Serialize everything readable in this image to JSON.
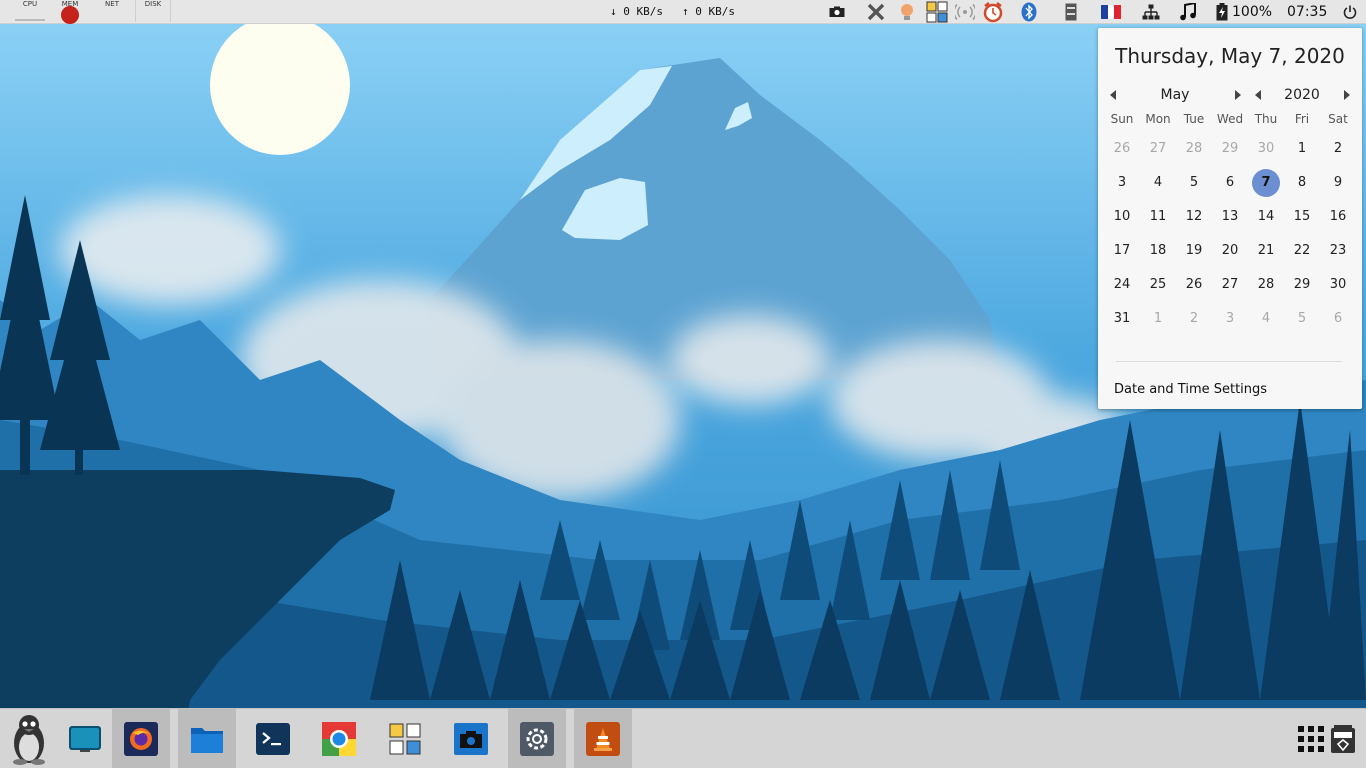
{
  "top_panel": {
    "monitors": {
      "cpu": "CPU",
      "mem": "MEM",
      "net": "NET",
      "disk": "DISK"
    },
    "net_down": "↓ 0 KB/s",
    "net_up": "↑ 0 KB/s",
    "battery": "100%",
    "clock": "07:35",
    "tray_icons": [
      "screenshot-icon",
      "crossed-tools-icon",
      "lightbulb-icon",
      "obconf-icon",
      "wireless-icon",
      "alarm-clock-icon",
      "bluetooth-icon",
      "archive-icon",
      "french-flag-icon",
      "network-icon",
      "music-note-icon",
      "battery-icon",
      "power-icon"
    ]
  },
  "calendar": {
    "date_title": "Thursday, May 7, 2020",
    "month": "May",
    "year": "2020",
    "weekdays": [
      "Sun",
      "Mon",
      "Tue",
      "Wed",
      "Thu",
      "Fri",
      "Sat"
    ],
    "weeks": [
      [
        "26",
        "27",
        "28",
        "29",
        "30",
        "1",
        "2"
      ],
      [
        "3",
        "4",
        "5",
        "6",
        "7",
        "8",
        "9"
      ],
      [
        "10",
        "11",
        "12",
        "13",
        "14",
        "15",
        "16"
      ],
      [
        "17",
        "18",
        "19",
        "20",
        "21",
        "22",
        "23"
      ],
      [
        "24",
        "25",
        "26",
        "27",
        "28",
        "29",
        "30"
      ],
      [
        "31",
        "1",
        "2",
        "3",
        "4",
        "5",
        "6"
      ]
    ],
    "today": "7",
    "settings_label": "Date and Time Settings"
  },
  "dock": {
    "items": [
      "linux-tux-icon",
      "screen-icon",
      "firefox-icon",
      "folder-icon",
      "terminal-icon",
      "chrome-icon",
      "obconf-icon",
      "camera-icon",
      "settings-gear-icon",
      "vlc-icon"
    ],
    "right_items": [
      "app-grid-icon",
      "trash-icon"
    ]
  },
  "colors": {
    "sky_top": "#8fd1f5",
    "sky_bottom": "#3c9ad4",
    "mountain": "#5aa0cf",
    "forest_dark": "#0d4166",
    "accent": "#6b8fd0"
  }
}
